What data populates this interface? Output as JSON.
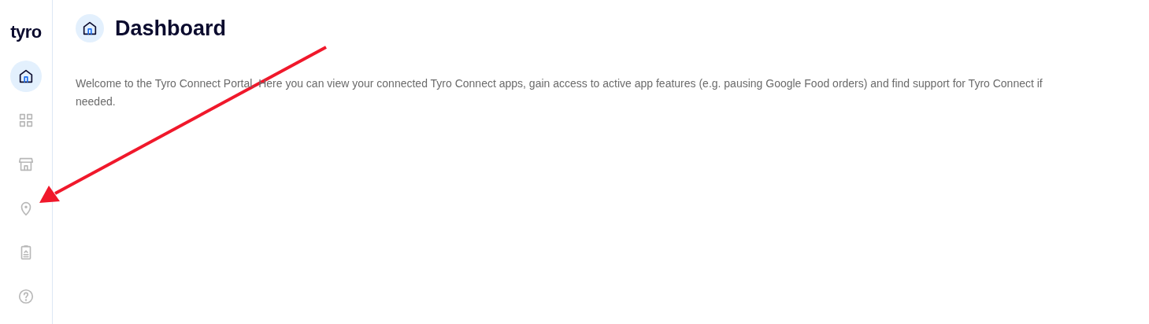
{
  "logo": "tyro",
  "sidebar": {
    "items": [
      {
        "kind": "home",
        "selected": true
      },
      {
        "kind": "grid",
        "selected": false
      },
      {
        "kind": "store",
        "selected": false
      },
      {
        "kind": "location",
        "selected": false
      },
      {
        "kind": "clipboard",
        "selected": false
      },
      {
        "kind": "help",
        "selected": false
      }
    ]
  },
  "page": {
    "title": "Dashboard",
    "description": "Welcome to the Tyro Connect Portal. Here you can view your connected Tyro Connect apps, gain access to active app features (e.g. pausing Google Food orders) and find support for Tyro Connect if needed."
  }
}
